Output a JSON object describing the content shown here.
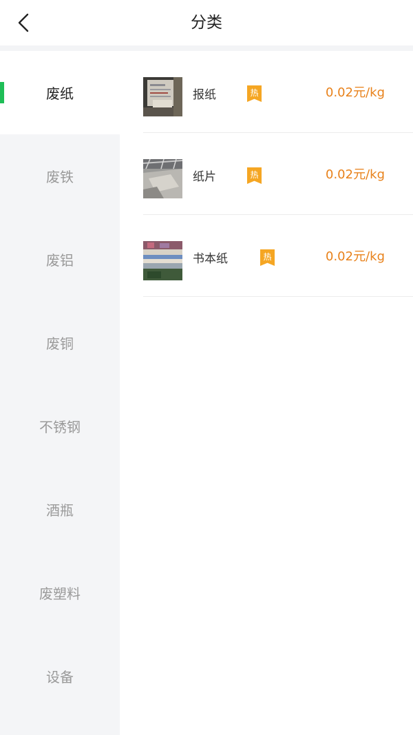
{
  "header": {
    "title": "分类",
    "back_icon": "chevron-left-icon"
  },
  "sidebar": {
    "active_index": 0,
    "accent_color": "#1fbe57",
    "items": [
      {
        "label": "废纸"
      },
      {
        "label": "废铁"
      },
      {
        "label": "废铝"
      },
      {
        "label": "废铜"
      },
      {
        "label": "不锈钢"
      },
      {
        "label": "酒瓶"
      },
      {
        "label": "废塑料"
      },
      {
        "label": "设备"
      }
    ]
  },
  "products": [
    {
      "name": "报纸",
      "badge": "热",
      "price": "0.02元/kg"
    },
    {
      "name": "纸片",
      "badge": "热",
      "price": "0.02元/kg"
    },
    {
      "name": "书本纸",
      "badge": "热",
      "price": "0.02元/kg"
    }
  ],
  "colors": {
    "price": "#e8811a",
    "badge": "#f5a623"
  }
}
